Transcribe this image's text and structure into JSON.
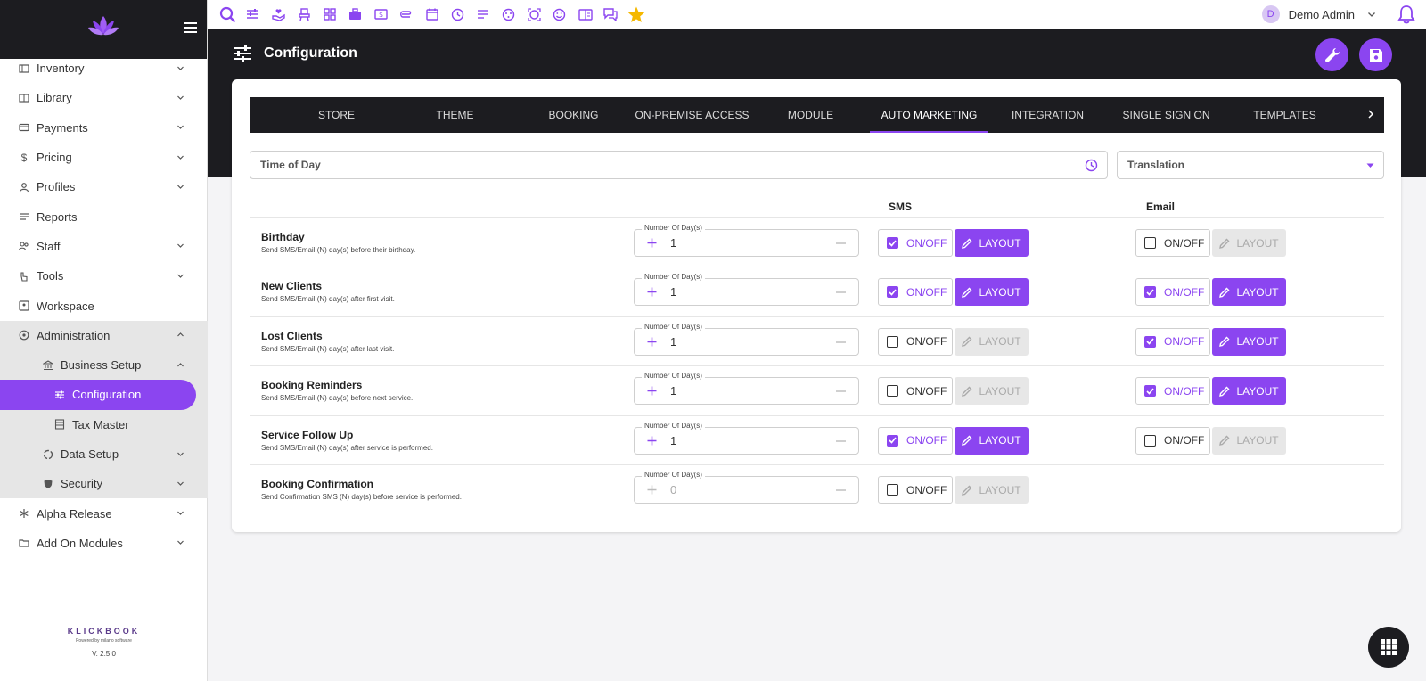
{
  "app": {
    "version": "V. 2.5.0",
    "brand": "KLICKBOOK",
    "powered": "Powered by milano software",
    "accent": "#8b45f0"
  },
  "topbar": {
    "user_initial": "D",
    "user_name": "Demo Admin"
  },
  "header": {
    "title": "Configuration"
  },
  "sidebar": {
    "items": [
      {
        "label": "Inventory",
        "icon": "inventory-icon"
      },
      {
        "label": "Library",
        "icon": "library-icon"
      },
      {
        "label": "Payments",
        "icon": "card-icon"
      },
      {
        "label": "Pricing",
        "icon": "dollar-icon"
      },
      {
        "label": "Profiles",
        "icon": "user-icon"
      },
      {
        "label": "Reports",
        "icon": "lines-icon"
      },
      {
        "label": "Staff",
        "icon": "users-icon"
      },
      {
        "label": "Tools",
        "icon": "hand-icon"
      },
      {
        "label": "Workspace",
        "icon": "workspace-icon"
      },
      {
        "label": "Administration",
        "icon": "admin-icon"
      },
      {
        "label": "Business Setup",
        "icon": "bank-icon"
      },
      {
        "label": "Configuration",
        "icon": "sliders-icon"
      },
      {
        "label": "Tax Master",
        "icon": "table-icon"
      },
      {
        "label": "Data Setup",
        "icon": "circle-icon"
      },
      {
        "label": "Security",
        "icon": "shield-icon"
      },
      {
        "label": "Alpha Release",
        "icon": "snowflake-icon"
      },
      {
        "label": "Add On Modules",
        "icon": "folder-icon"
      }
    ]
  },
  "tabs": [
    {
      "label": "STORE"
    },
    {
      "label": "THEME"
    },
    {
      "label": "BOOKING"
    },
    {
      "label": "ON-PREMISE ACCESS"
    },
    {
      "label": "MODULE"
    },
    {
      "label": "AUTO MARKETING"
    },
    {
      "label": "INTEGRATION"
    },
    {
      "label": "SINGLE SIGN ON"
    },
    {
      "label": "TEMPLATES"
    }
  ],
  "filters": {
    "time_of_day": "Time of Day",
    "translation": "Translation"
  },
  "columns": {
    "sms": "SMS",
    "email": "Email"
  },
  "labels": {
    "days": "Number Of Day(s)",
    "onoff": "ON/OFF",
    "layout": "LAYOUT"
  },
  "rows": [
    {
      "title": "Birthday",
      "desc": "Send SMS/Email (N) day(s) before their birthday.",
      "days": "1",
      "sms_on": true,
      "email_on": false,
      "email": true
    },
    {
      "title": "New Clients",
      "desc": "Send SMS/Email (N) day(s) after first visit.",
      "days": "1",
      "sms_on": true,
      "email_on": true,
      "email": true
    },
    {
      "title": "Lost Clients",
      "desc": "Send SMS/Email (N) day(s) after last visit.",
      "days": "1",
      "sms_on": false,
      "email_on": true,
      "email": true
    },
    {
      "title": "Booking Reminders",
      "desc": "Send SMS/Email (N) day(s) before next service.",
      "days": "1",
      "sms_on": false,
      "email_on": true,
      "email": true
    },
    {
      "title": "Service Follow Up",
      "desc": "Send SMS/Email (N) day(s) after service is performed.",
      "days": "1",
      "sms_on": true,
      "email_on": false,
      "email": true
    },
    {
      "title": "Booking Confirmation",
      "desc": "Send Confirmation SMS (N) day(s) before service is performed.",
      "days": "0",
      "sms_on": false,
      "email_on": false,
      "email": false
    }
  ]
}
